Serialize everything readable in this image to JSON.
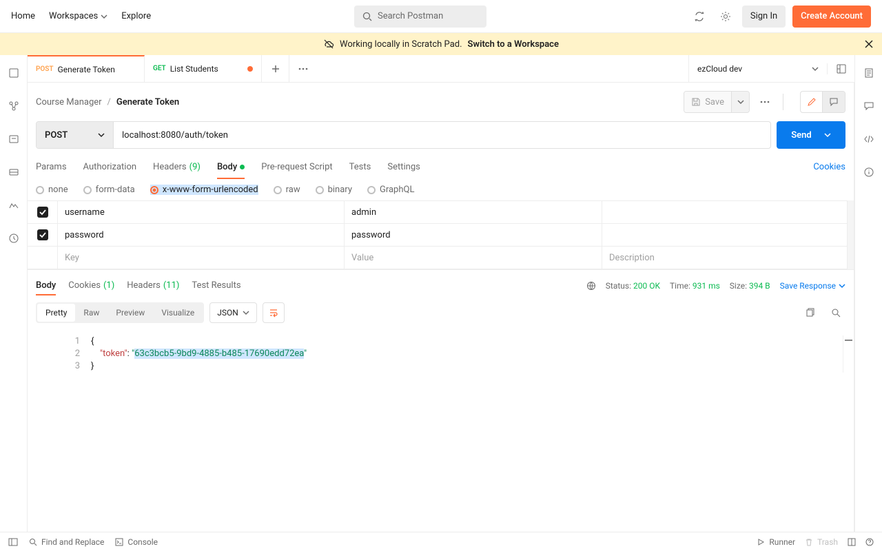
{
  "topnav": {
    "home": "Home",
    "workspaces": "Workspaces",
    "explore": "Explore",
    "search_placeholder": "Search Postman",
    "signin": "Sign In",
    "create": "Create Account"
  },
  "banner": {
    "prefix": "Working locally in Scratch Pad.",
    "link": "Switch to a Workspace"
  },
  "tabs": [
    {
      "method": "POST",
      "method_cls": "post",
      "title": "Generate Token",
      "unsaved": false,
      "active": true
    },
    {
      "method": "GET",
      "method_cls": "get",
      "title": "List Students",
      "unsaved": true,
      "active": false
    }
  ],
  "env": {
    "name": "ezCloud dev"
  },
  "breadcrumb": {
    "parent": "Course Manager",
    "current": "Generate Token"
  },
  "save_label": "Save",
  "request": {
    "method": "POST",
    "url": "localhost:8080/auth/token",
    "send": "Send",
    "tabs": {
      "params": "Params",
      "auth": "Authorization",
      "headers": "Headers",
      "headers_n": "(9)",
      "body": "Body",
      "prereq": "Pre-request Script",
      "tests": "Tests",
      "settings": "Settings",
      "cookies": "Cookies"
    },
    "body_types": {
      "none": "none",
      "form": "form-data",
      "xwww": "x-www-form-urlencoded",
      "raw": "raw",
      "binary": "binary",
      "graphql": "GraphQL"
    },
    "params": [
      {
        "key": "username",
        "value": "admin"
      },
      {
        "key": "password",
        "value": "password"
      }
    ],
    "placeholders": {
      "key": "Key",
      "value": "Value",
      "desc": "Description"
    }
  },
  "response": {
    "tabs": {
      "body": "Body",
      "cookies": "Cookies",
      "cookies_n": "(1)",
      "headers": "Headers",
      "headers_n": "(11)",
      "tests": "Test Results"
    },
    "status_label": "Status:",
    "status": "200 OK",
    "time_label": "Time:",
    "time": "931 ms",
    "size_label": "Size:",
    "size": "394 B",
    "save": "Save Response",
    "views": {
      "pretty": "Pretty",
      "raw": "Raw",
      "preview": "Preview",
      "visualize": "Visualize"
    },
    "format": "JSON",
    "lines": [
      "1",
      "2",
      "3"
    ],
    "json": {
      "open": "{",
      "key": "\"token\"",
      "colon": ": ",
      "q1": "\"",
      "val": "63c3bcb5-9bd9-4885-b485-17690edd72ea",
      "q2": "\"",
      "close": "}"
    }
  },
  "footer": {
    "find": "Find and Replace",
    "console": "Console",
    "runner": "Runner",
    "trash": "Trash"
  }
}
